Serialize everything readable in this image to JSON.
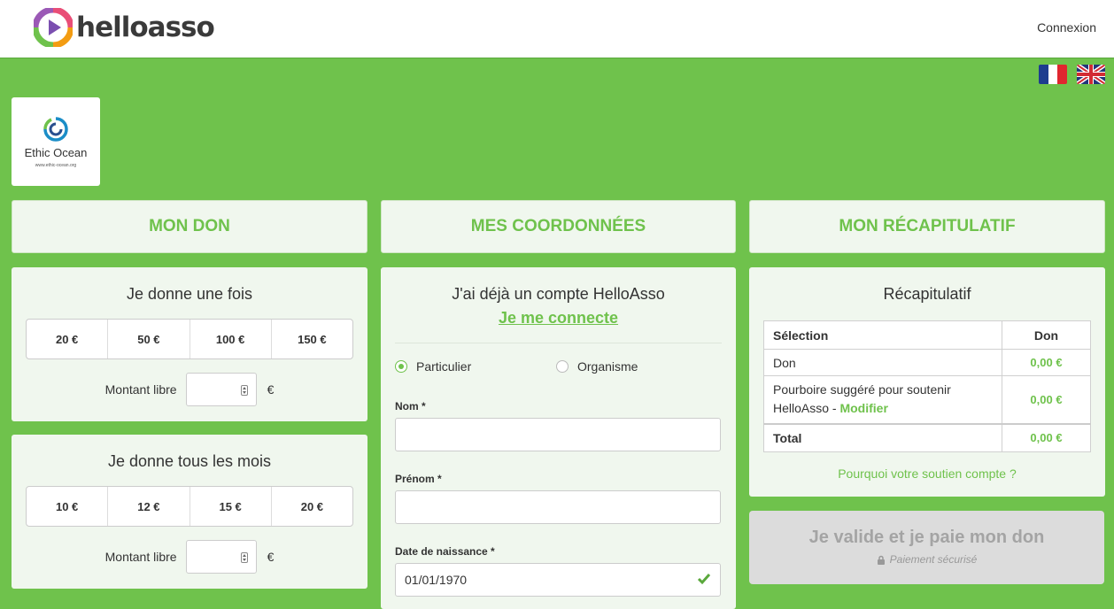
{
  "header": {
    "brand": "helloasso",
    "login_link": "Connexion"
  },
  "languages": [
    {
      "icon": "french-flag-icon"
    },
    {
      "icon": "uk-flag-icon"
    }
  ],
  "organization": {
    "name": "Ethic Ocean",
    "url": "www.ethic-ocean.org"
  },
  "steps": [
    "MON DON",
    "MES COORDONNÉES",
    "MON RÉCAPITULATIF"
  ],
  "donation": {
    "once": {
      "title": "Je donne une fois",
      "amounts": [
        "20 €",
        "50 €",
        "100 €",
        "150 €"
      ],
      "free_label": "Montant libre",
      "currency": "€",
      "free_value": ""
    },
    "monthly": {
      "title": "Je donne tous les mois",
      "amounts": [
        "10 €",
        "12 €",
        "15 €",
        "20 €"
      ],
      "free_label": "Montant libre",
      "currency": "€",
      "free_value": ""
    }
  },
  "contact": {
    "account_prompt": "J'ai déjà un compte HelloAsso",
    "login_link": "Je me connecte",
    "type_options": [
      {
        "label": "Particulier",
        "selected": true
      },
      {
        "label": "Organisme",
        "selected": false
      }
    ],
    "fields": [
      {
        "label": "Nom *",
        "value": ""
      },
      {
        "label": "Prénom *",
        "value": ""
      },
      {
        "label": "Date de naissance *",
        "value": "01/01/1970"
      }
    ]
  },
  "summary": {
    "title": "Récapitulatif",
    "col_selection": "Sélection",
    "col_don": "Don",
    "rows": [
      {
        "label": "Don",
        "value": "0,00 €"
      },
      {
        "label": "Pourboire suggéré pour soutenir HelloAsso - ",
        "link": "Modifier",
        "value": "0,00 €"
      }
    ],
    "total_label": "Total",
    "total_value": "0,00 €",
    "why_link": "Pourquoi votre soutien compte ?"
  },
  "pay": {
    "label": "Je valide et je paie mon don",
    "secure": "Paiement sécurisé"
  },
  "colors": {
    "brand_green": "#6fc24c",
    "card_bg": "#f0f7ee",
    "disabled_btn": "#dcdcdc"
  }
}
